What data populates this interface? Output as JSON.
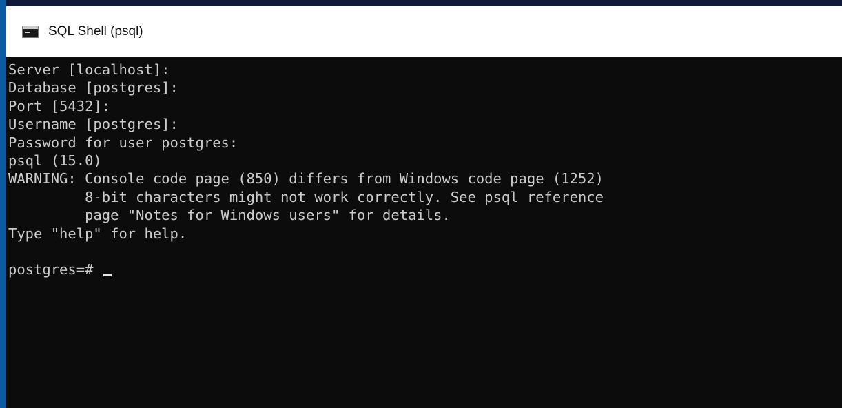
{
  "window": {
    "title": "SQL Shell (psql)",
    "icon": "console-window-icon"
  },
  "colors": {
    "background": "#0c0c0c",
    "text": "#cccccc",
    "titlebar": "#ffffff"
  },
  "console": {
    "lines": [
      "Server [localhost]:",
      "Database [postgres]:",
      "Port [5432]:",
      "Username [postgres]:",
      "Password for user postgres:",
      "psql (15.0)",
      "WARNING: Console code page (850) differs from Windows code page (1252)",
      "         8-bit characters might not work correctly. See psql reference",
      "         page \"Notes for Windows users\" for details.",
      "Type \"help\" for help.",
      ""
    ],
    "prompt": "postgres=# "
  }
}
